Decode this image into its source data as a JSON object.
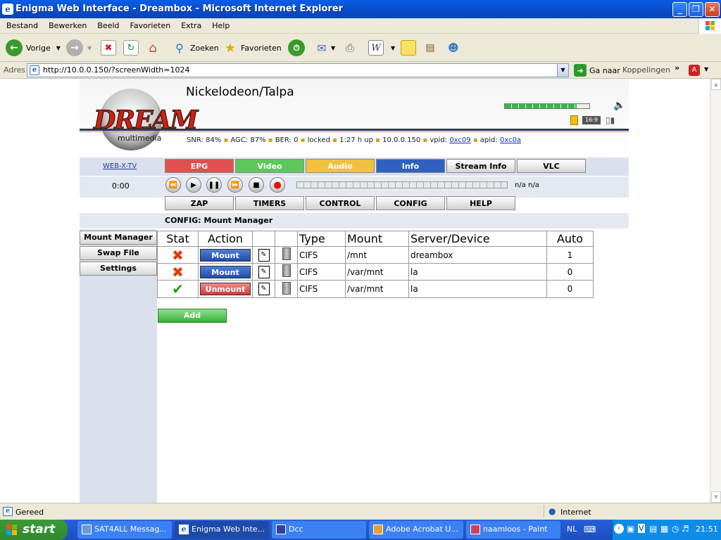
{
  "window": {
    "title": "Enigma Web Interface - Dreambox - Microsoft Internet Explorer",
    "buttons": [
      "_",
      "❐",
      "✕"
    ]
  },
  "menu": [
    "Bestand",
    "Bewerken",
    "Beeld",
    "Favorieten",
    "Extra",
    "Help"
  ],
  "toolbar": {
    "back": "Vorige",
    "search": "Zoeken",
    "favorites": "Favorieten"
  },
  "address": {
    "label": "Adres",
    "url": "http://10.0.0.150/?screenWidth=1024",
    "go": "Ga naar",
    "links": "Koppelingen"
  },
  "dreambox": {
    "logo_text": "DREAM",
    "logo_sub": "multimedia",
    "channel": "Nickelodeon/Talpa",
    "signal_level": 0.85,
    "aspect": "16:9",
    "status": {
      "snr": "SNR: 84%",
      "agc": "AGC: 87%",
      "ber": "BER: 0",
      "lock": "locked",
      "uptime": "1:27 h up",
      "ip": "10.0.0.150",
      "vpid_label": "vpid:",
      "vpid": "0xc09",
      "apid_label": "apid:",
      "apid": "0xc0a"
    },
    "webxtv": "WEB-X-TV",
    "tabs": [
      {
        "label": "EPG",
        "color": "#e05050"
      },
      {
        "label": "Video",
        "color": "#5cc85c"
      },
      {
        "label": "Audio",
        "color": "#f2c040"
      },
      {
        "label": "Info",
        "color": "#3060c0"
      },
      {
        "label": "Stream Info",
        "color": "#e8e8e8"
      },
      {
        "label": "VLC",
        "color": "#e8e8e8"
      }
    ],
    "time": "0:00",
    "na": "n/a n/a",
    "mainnav": [
      "ZAP",
      "TIMERS",
      "CONTROL",
      "CONFIG",
      "HELP"
    ],
    "breadcrumb": "CONFIG: Mount Manager",
    "sidebar": [
      "Mount Manager",
      "Swap File",
      "Settings"
    ],
    "table": {
      "headers": [
        "Stat",
        "Action",
        "",
        "",
        "Type",
        "Mount",
        "Server/Device",
        "Auto"
      ],
      "rows": [
        {
          "stat": "error",
          "action": "Mount",
          "type": "CIFS",
          "mount": "/mnt",
          "server": "dreambox",
          "auto": "1"
        },
        {
          "stat": "error",
          "action": "Mount",
          "type": "CIFS",
          "mount": "/var/mnt",
          "server": "la",
          "auto": "0"
        },
        {
          "stat": "ok",
          "action": "Unmount",
          "type": "CIFS",
          "mount": "/var/mnt",
          "server": "la",
          "auto": "0"
        }
      ]
    },
    "add": "Add"
  },
  "statusbar": {
    "left": "Gereed",
    "zone": "Internet"
  },
  "taskbar": {
    "start": "start",
    "tasks": [
      "SAT4ALL Messag...",
      "Enigma Web Inte...",
      "Dcc",
      "Adobe Acrobat U...",
      "naamloos - Paint"
    ],
    "lang": "NL",
    "clock": "21:51"
  }
}
